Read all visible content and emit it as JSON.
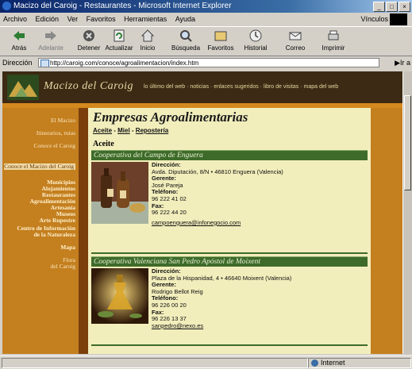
{
  "window": {
    "title": "Macizo del Caroig - Restaurantes - Microsoft Internet Explorer"
  },
  "menu": [
    "Archivo",
    "Edición",
    "Ver",
    "Favoritos",
    "Herramientas",
    "Ayuda"
  ],
  "menu_right": "Vínculos",
  "toolbar": {
    "back": "Atrás",
    "forward": "Adelante",
    "stop": "Detener",
    "refresh": "Actualizar",
    "home": "Inicio",
    "search": "Búsqueda",
    "favorites": "Favoritos",
    "history": "Historial",
    "mail": "Correo",
    "print": "Imprimir"
  },
  "address": {
    "label": "Dirección",
    "url": "http://caroig.com/conoce/agroalimentacion/index.htm",
    "go": "Ir a"
  },
  "site": {
    "name": "Macizo del Caroig",
    "nav": "lo último del web · noticias · enlaces sugeridos · libro de visitas · mapa del web"
  },
  "sidebar": [
    "El Macizo",
    "Itinerarios, rutas",
    "Conoce el Caroig",
    "Conoce el Macizo del Caroig",
    "Municipios",
    "Alojamientos",
    "Restaurantes",
    "Agroalimentación",
    "Artesanía",
    "Museos",
    "Arte Rupestre",
    "Centro de Información de la Naturaleza",
    "Mapa",
    "Flora",
    "del Caroig"
  ],
  "main": {
    "title": "Empresas Agroalimentarias",
    "sub_links": [
      "Aceite",
      "Miel",
      "Repostería"
    ],
    "section": "Aceite",
    "companies": [
      {
        "name": "Cooperativa del Campo de Enguera",
        "dir_label": "Dirección:",
        "address": "Avda. Diputación, 8/N • 46810 Enguera (Valencia)",
        "manager_label": "Gerente:",
        "manager": "José Pareja",
        "phone_label": "Teléfono:",
        "phone": "96 222 41 02",
        "fax_label": "Fax:",
        "fax": "96 222 44 20",
        "email": "campoenguera@infonegocio.com"
      },
      {
        "name": "Cooperativa Valenciana San Pedro Apóstol de Moixent",
        "dir_label": "Dirección:",
        "address": "Plaza de la Hispanidad, 4 • 46640 Moixent (Valencia)",
        "manager_label": "Gerente:",
        "manager": "Rodrigo Bellot Reig",
        "phone_label": "Teléfono:",
        "phone": "96 226 00 20",
        "fax_label": "Fax:",
        "fax": "96 226 13 37",
        "email": "sanpedro@nexo.es"
      }
    ]
  },
  "status": {
    "zone": "Internet"
  }
}
